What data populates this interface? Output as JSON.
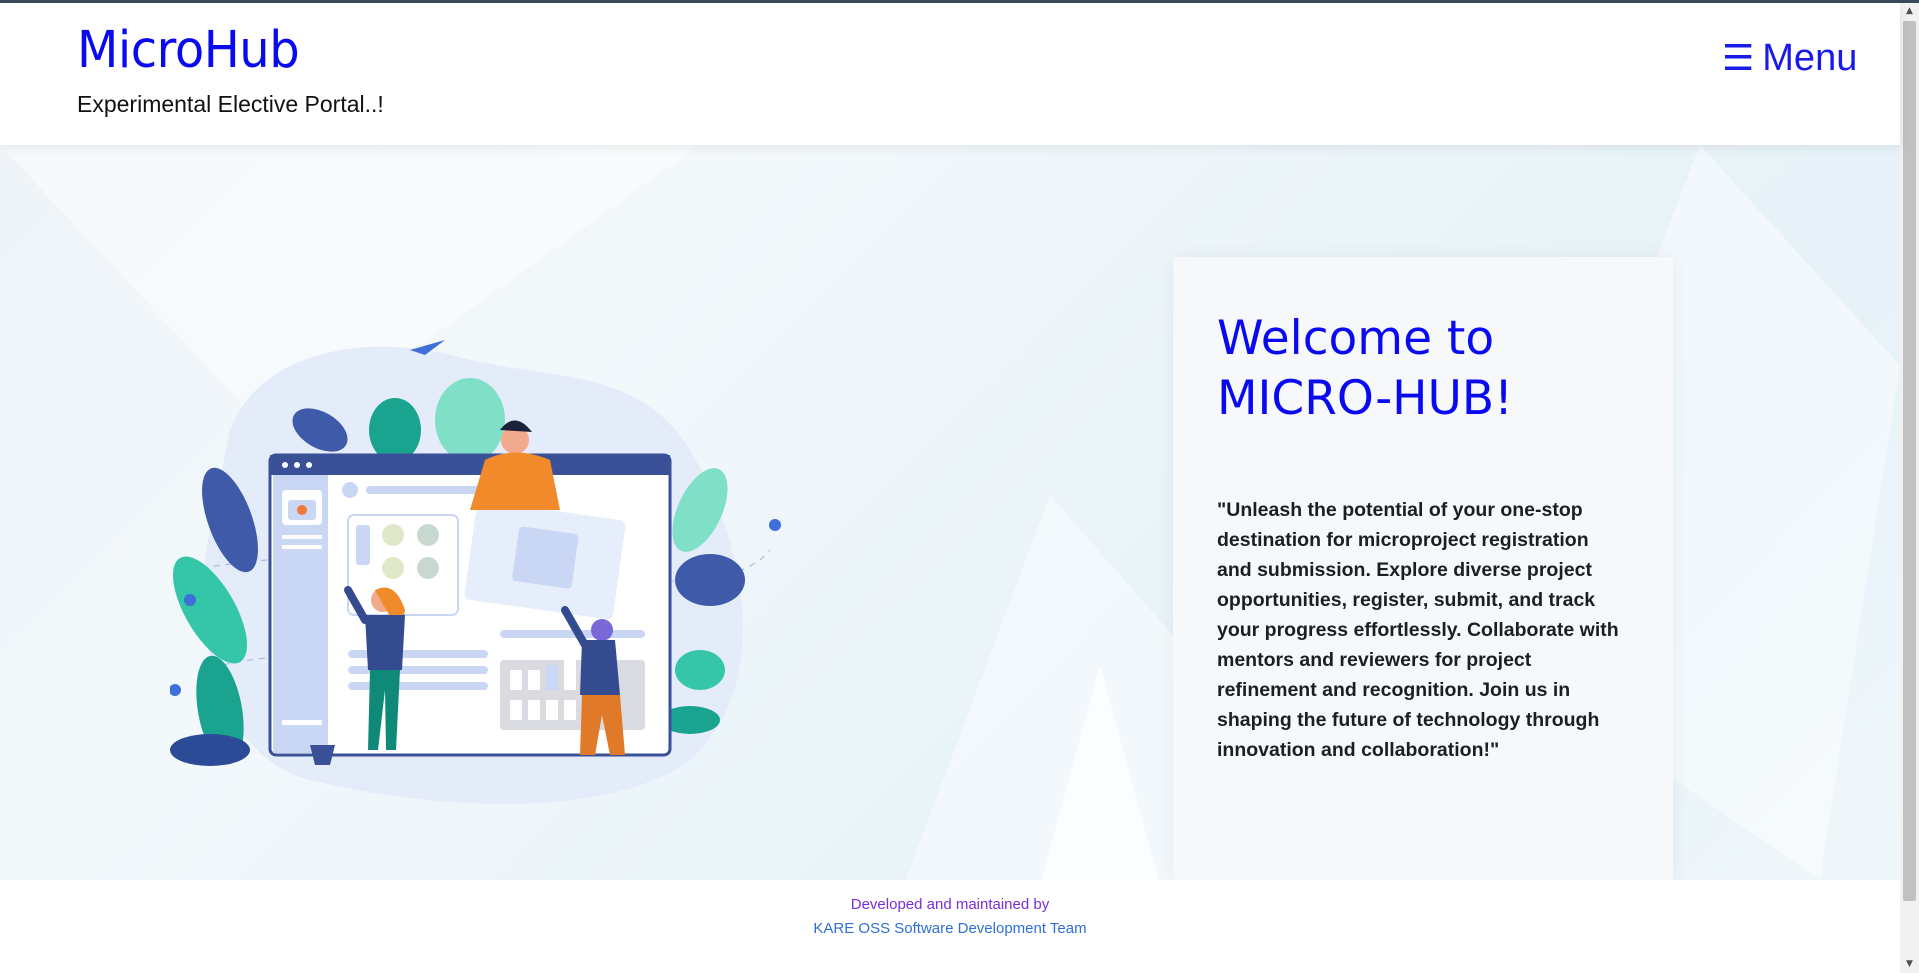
{
  "header": {
    "brand": "MicroHub",
    "subtitle": "Experimental Elective Portal..!",
    "menu_icon": "☰",
    "menu_label": "Menu"
  },
  "hero": {
    "title": "Welcome to MICRO-HUB!",
    "description": "\"Unleash the potential of your one-stop destination for microproject registration and submission. Explore diverse project opportunities, register, submit, and track your progress effortlessly. Collaborate with mentors and reviewers for project refinement and recognition. Join us in shaping the future of technology through innovation and collaboration!\"",
    "illustration_icon": "team-building-website-illustration"
  },
  "footer": {
    "line1": "Developed and maintained by",
    "line2": "KARE OSS Software Development Team"
  },
  "colors": {
    "brand_blue": "#0a0af0",
    "menu_blue": "#1a1ae8",
    "footer_purple": "#7a2fd6",
    "footer_link": "#2f6fd6"
  }
}
